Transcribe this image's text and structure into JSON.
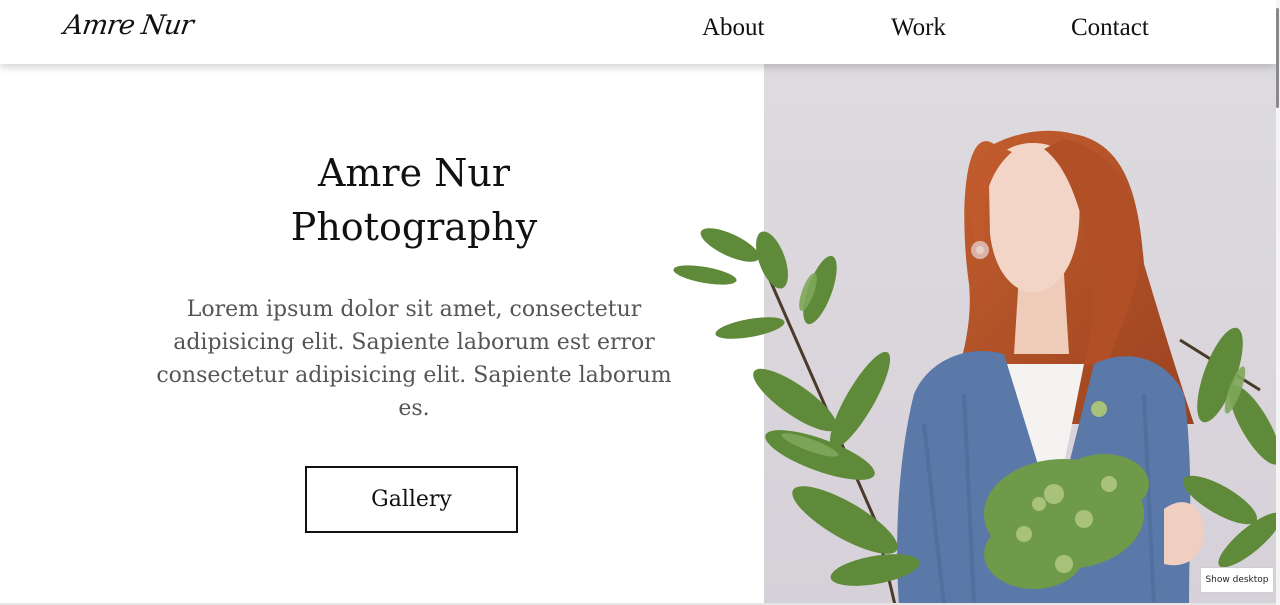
{
  "header": {
    "logo": "Amre Nur",
    "nav": [
      {
        "label": "About"
      },
      {
        "label": "Work"
      },
      {
        "label": "Contact"
      }
    ]
  },
  "hero": {
    "title_line1": "Amre Nur",
    "title_line2": "Photography",
    "description": "Lorem ipsum dolor sit amet, consectetur adipisicing elit. Sapiente laborum est error consectetur adipisicing elit. Sapiente laborum es.",
    "button_label": "Gallery"
  },
  "overlay": {
    "show_desktop_label": "Show desktop"
  },
  "colors": {
    "text_dark": "#111111",
    "text_muted": "#555555",
    "photo_bg": "#dcd8dd",
    "sweater_blue": "#5a78a8",
    "hair": "#b8532a",
    "leaf_green": "#5e8a3a"
  },
  "icons": {
    "photo": "woman-with-flowers-photo",
    "plants": "leaf-plants-decoration"
  }
}
